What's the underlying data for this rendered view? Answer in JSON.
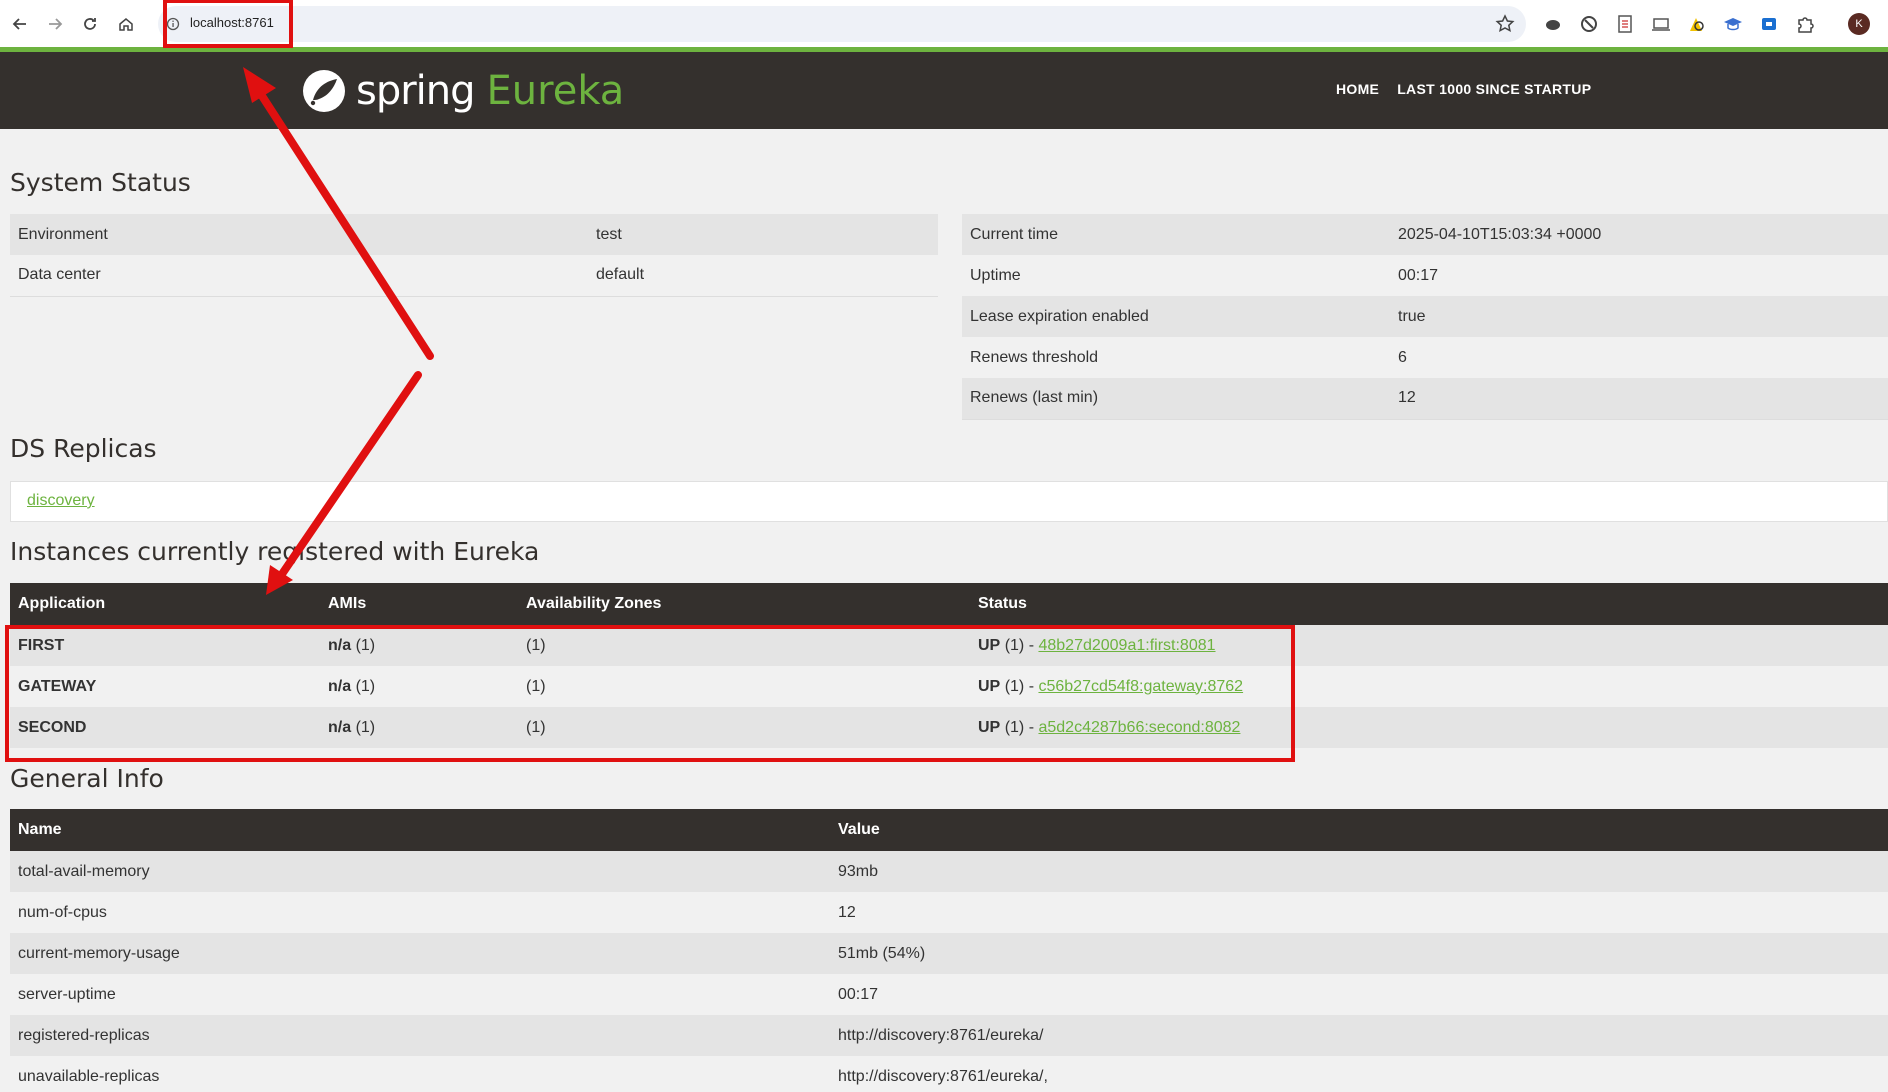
{
  "browser": {
    "url": "localhost:8761",
    "avatar_initial": "K"
  },
  "header": {
    "logo_spring": "spring",
    "logo_eureka": "Eureka",
    "nav": [
      "HOME",
      "LAST 1000 SINCE STARTUP"
    ]
  },
  "system_status": {
    "title": "System Status",
    "left": [
      {
        "label": "Environment",
        "value": "test"
      },
      {
        "label": "Data center",
        "value": "default"
      }
    ],
    "right": [
      {
        "label": "Current time",
        "value": "2025-04-10T15:03:34 +0000"
      },
      {
        "label": "Uptime",
        "value": "00:17"
      },
      {
        "label": "Lease expiration enabled",
        "value": "true"
      },
      {
        "label": "Renews threshold",
        "value": "6"
      },
      {
        "label": "Renews (last min)",
        "value": "12"
      }
    ]
  },
  "ds_replicas": {
    "title": "DS Replicas",
    "link": "discovery"
  },
  "instances": {
    "title": "Instances currently registered with Eureka",
    "headers": [
      "Application",
      "AMIs",
      "Availability Zones",
      "Status"
    ],
    "rows": [
      {
        "app": "FIRST",
        "ami": "n/a",
        "ami_count": "(1)",
        "zones": "(1)",
        "status": "UP",
        "status_count": "(1) - ",
        "link": "48b27d2009a1:first:8081"
      },
      {
        "app": "GATEWAY",
        "ami": "n/a",
        "ami_count": "(1)",
        "zones": "(1)",
        "status": "UP",
        "status_count": "(1) - ",
        "link": "c56b27cd54f8:gateway:8762"
      },
      {
        "app": "SECOND",
        "ami": "n/a",
        "ami_count": "(1)",
        "zones": "(1)",
        "status": "UP",
        "status_count": "(1) - ",
        "link": "a5d2c4287b66:second:8082"
      }
    ]
  },
  "general_info": {
    "title": "General Info",
    "headers": [
      "Name",
      "Value"
    ],
    "rows": [
      {
        "name": "total-avail-memory",
        "value": "93mb"
      },
      {
        "name": "num-of-cpus",
        "value": "12"
      },
      {
        "name": "current-memory-usage",
        "value": "51mb (54%)"
      },
      {
        "name": "server-uptime",
        "value": "00:17"
      },
      {
        "name": "registered-replicas",
        "value": "http://discovery:8761/eureka/"
      },
      {
        "name": "unavailable-replicas",
        "value": "http://discovery:8761/eureka/,"
      }
    ]
  },
  "colors": {
    "brand_green": "#6db33f",
    "header_dark": "#34302d",
    "annotation_red": "#e01010"
  }
}
